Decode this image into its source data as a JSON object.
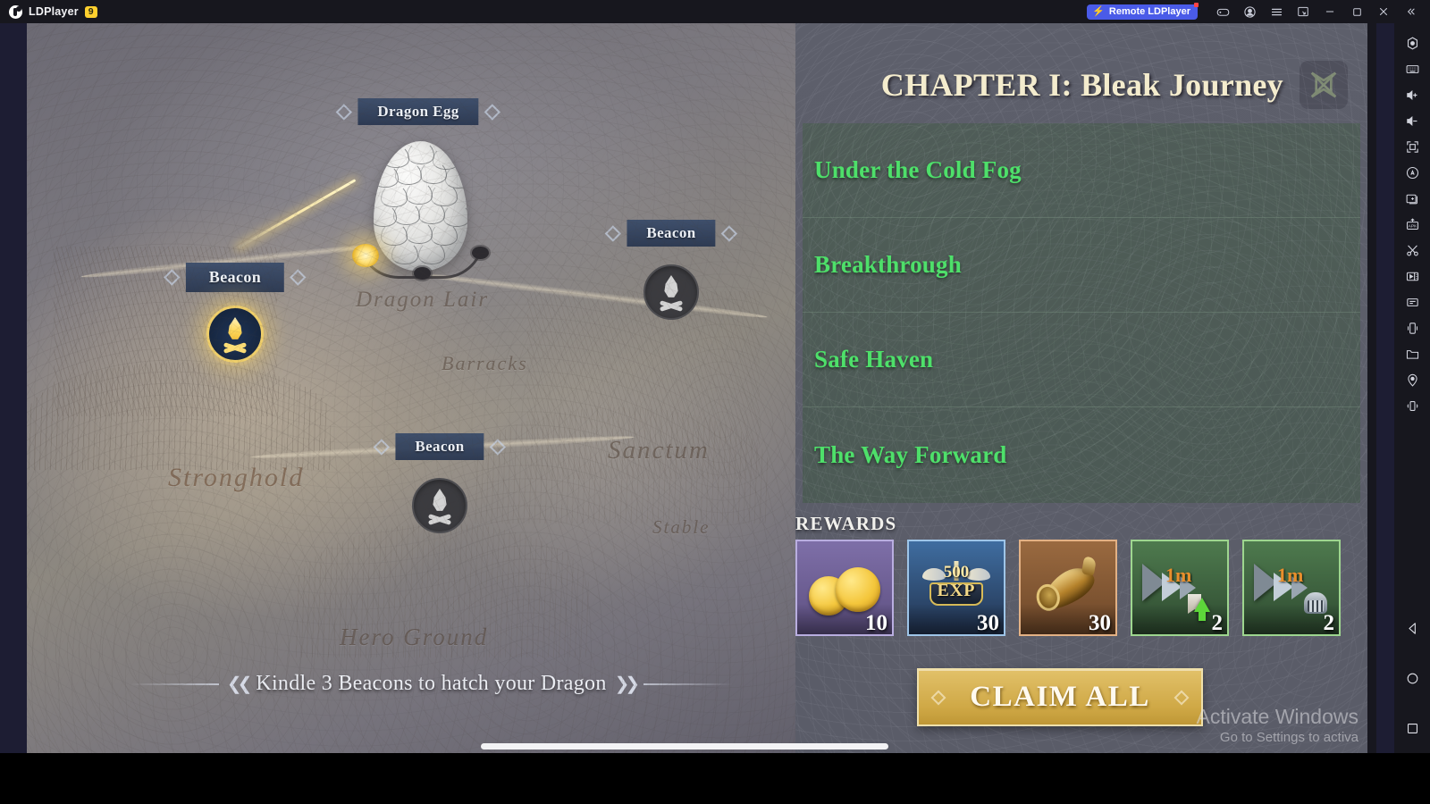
{
  "titlebar": {
    "app_name": "LDPlayer",
    "version_badge": "9",
    "remote_button": "Remote LDPlayer",
    "icons": [
      {
        "name": "gamepad-icon"
      },
      {
        "name": "account-icon"
      },
      {
        "name": "menu-icon"
      },
      {
        "name": "screenshot-icon"
      },
      {
        "name": "minimize-icon"
      },
      {
        "name": "maximize-icon"
      },
      {
        "name": "close-icon"
      },
      {
        "name": "collapse-icon"
      }
    ]
  },
  "map": {
    "egg_label": "Dragon Egg",
    "beacons": [
      {
        "label": "Beacon",
        "state": "active"
      },
      {
        "label": "Beacon",
        "state": "inactive"
      },
      {
        "label": "Beacon",
        "state": "inactive"
      }
    ],
    "places": [
      {
        "name": "Dragon Lair"
      },
      {
        "name": "Barracks"
      },
      {
        "name": "Stronghold"
      },
      {
        "name": "Sanctum"
      },
      {
        "name": "Stable"
      },
      {
        "name": "Hero Ground"
      }
    ],
    "hint": "Kindle 3 Beacons to hatch your Dragon",
    "egg_progress": {
      "lit": 1,
      "total": 3
    }
  },
  "panel": {
    "chapter_title": "CHAPTER I: Bleak Journey",
    "close_icon": "celtic-knot-close-icon",
    "quests": [
      {
        "name": "Under the Cold Fog"
      },
      {
        "name": "Breakthrough"
      },
      {
        "name": "Safe Haven"
      },
      {
        "name": "The Way Forward"
      }
    ],
    "rewards_label": "REWARDS",
    "rewards": [
      {
        "item": "gold-coins",
        "qty": "10",
        "rarity_color": "#7a6a9e"
      },
      {
        "item": "exp-crown",
        "qty": "30",
        "rarity_color": "#5d8cc4",
        "badge_value": "500",
        "badge_unit": "EXP"
      },
      {
        "item": "war-horn",
        "qty": "30",
        "rarity_color": "#c08b5a"
      },
      {
        "item": "speedup-1m-troop",
        "qty": "2",
        "rarity_color": "#6fae6a",
        "duration": "1m"
      },
      {
        "item": "speedup-1m-research",
        "qty": "2",
        "rarity_color": "#6fae6a",
        "duration": "1m"
      }
    ],
    "claim_button": "CLAIM ALL"
  },
  "sidebar": {
    "items": [
      {
        "name": "settings-icon"
      },
      {
        "name": "keyboard-icon"
      },
      {
        "name": "volume-up-icon"
      },
      {
        "name": "volume-down-icon"
      },
      {
        "name": "fullscreen-icon"
      },
      {
        "name": "auto-rotate-icon"
      },
      {
        "name": "multi-instance-icon"
      },
      {
        "name": "apk-install-icon"
      },
      {
        "name": "scissors-icon"
      },
      {
        "name": "video-record-icon"
      },
      {
        "name": "operation-record-icon"
      },
      {
        "name": "shake-icon"
      },
      {
        "name": "folder-icon"
      },
      {
        "name": "location-icon"
      },
      {
        "name": "vibrate-icon"
      }
    ],
    "nav": [
      {
        "name": "back-icon"
      },
      {
        "name": "home-icon"
      },
      {
        "name": "recents-icon"
      }
    ]
  },
  "watermark": {
    "line1": "Activate Windows",
    "line2": "Go to Settings to activa"
  }
}
